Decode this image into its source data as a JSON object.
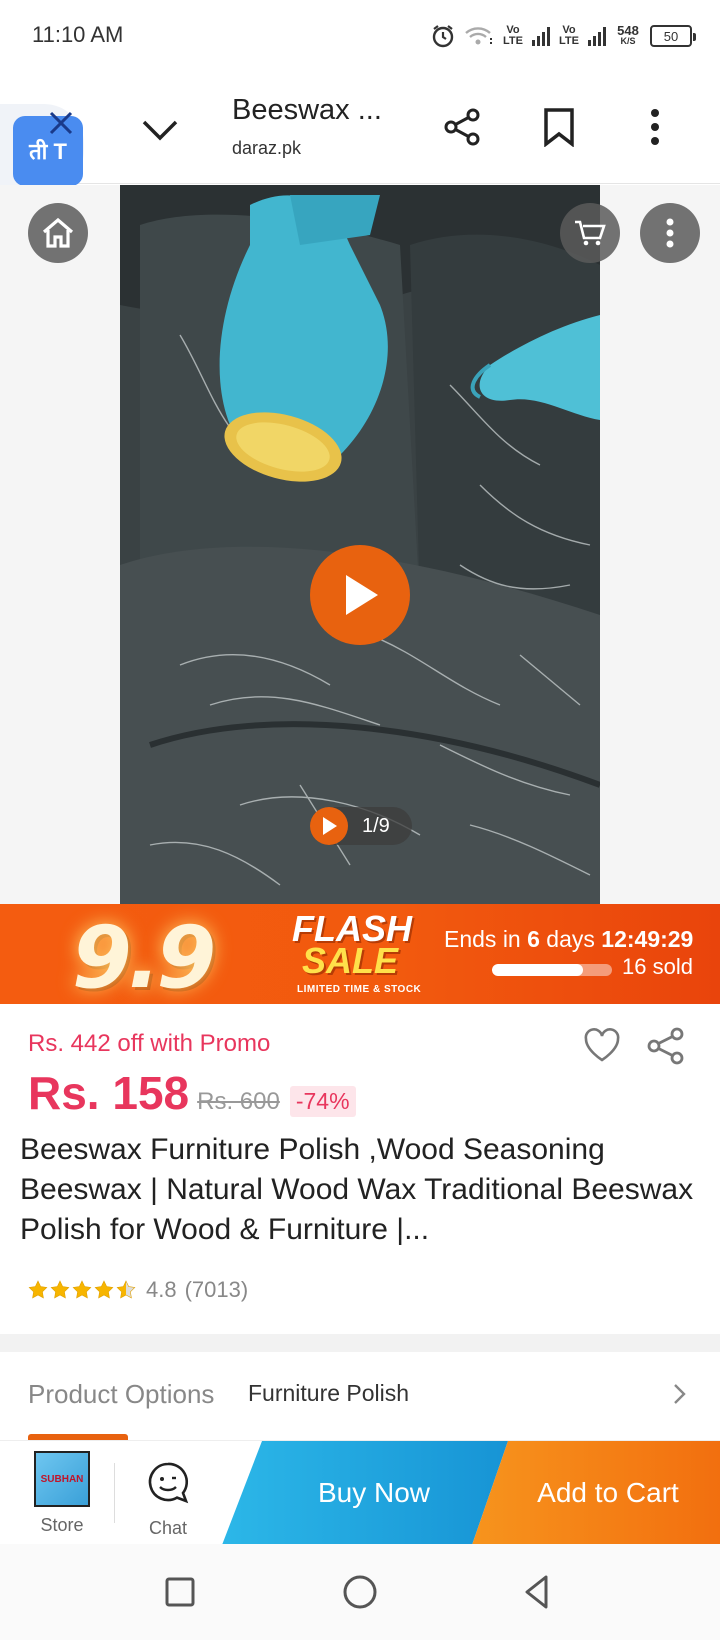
{
  "status_bar": {
    "time": "11:10 AM",
    "net1": "Vo LTE",
    "net2": "Vo LTE",
    "speed_value": "548",
    "speed_unit": "K/S",
    "battery": "50"
  },
  "browser": {
    "title": "Beeswax ...",
    "domain": "daraz.pk",
    "translate_label": "ती T"
  },
  "media": {
    "counter": "1/9"
  },
  "flash_sale": {
    "number": "9.9",
    "word1": "FLASH",
    "word2": "SALE",
    "subtitle": "LIMITED TIME & STOCK",
    "ends_prefix": "Ends in",
    "ends_days": "6",
    "ends_days_label": "days",
    "ends_time": "12:49:29",
    "sold": "16 sold",
    "sold_fraction": 0.76
  },
  "product": {
    "promo": "Rs. 442 off with Promo",
    "price": "Rs. 158",
    "original_price": "Rs. 600",
    "discount": "-74%",
    "title": "Beeswax Furniture Polish ,Wood Seasoning Beeswax | Natural Wood Wax Traditional Beeswax Polish for Wood & Furniture |...",
    "rating": "4.8",
    "rating_count": "(7013)",
    "rating_stars": 4.5
  },
  "options": {
    "label": "Product Options",
    "value": "Furniture Polish"
  },
  "actions": {
    "store_label": "Store",
    "store_logo_text": "SUBHAN",
    "chat_label": "Chat",
    "buy_now": "Buy Now",
    "add_to_cart": "Add to Cart"
  },
  "colors": {
    "accent_orange": "#e8620f",
    "price_red": "#e8365d",
    "buy_blue": "#1794d5",
    "cart_orange": "#f26f0f"
  }
}
